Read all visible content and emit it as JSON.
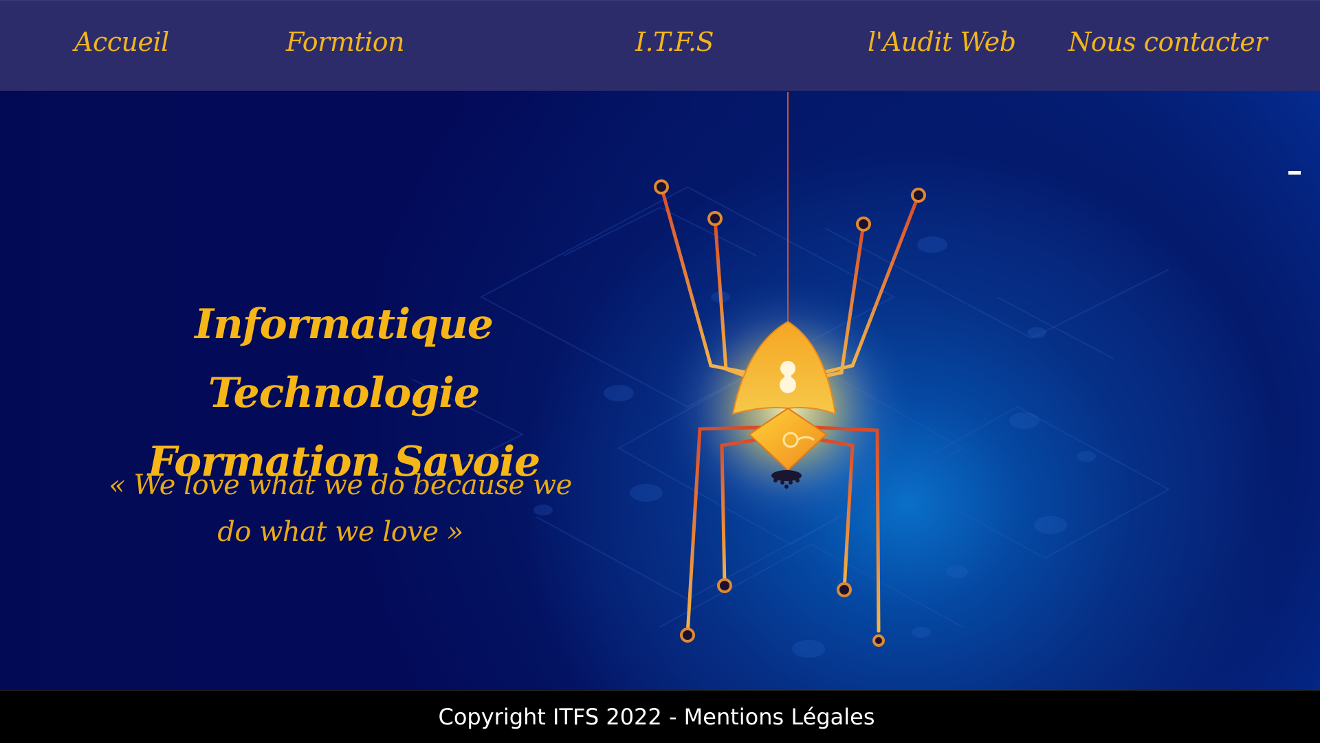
{
  "nav": {
    "items": [
      {
        "label": "Accueil"
      },
      {
        "label": "Formtion"
      },
      {
        "label": "I.T.F.S"
      },
      {
        "label": "l'Audit Web"
      },
      {
        "label": "Nous contacter"
      }
    ]
  },
  "hero": {
    "title_line1": "Informatique Technologie",
    "title_line2": "Formation Savoie",
    "quote": "« We love what we do because we do what we love »"
  },
  "footer": {
    "text": "Copyright ITFS 2022 - Mentions Légales"
  },
  "colors": {
    "accent": "#f2b51c",
    "nav_bg": "#2d2c6b",
    "hero_dark": "#030a55",
    "hero_glow": "#0a6fc8",
    "footer_bg": "#000000"
  }
}
